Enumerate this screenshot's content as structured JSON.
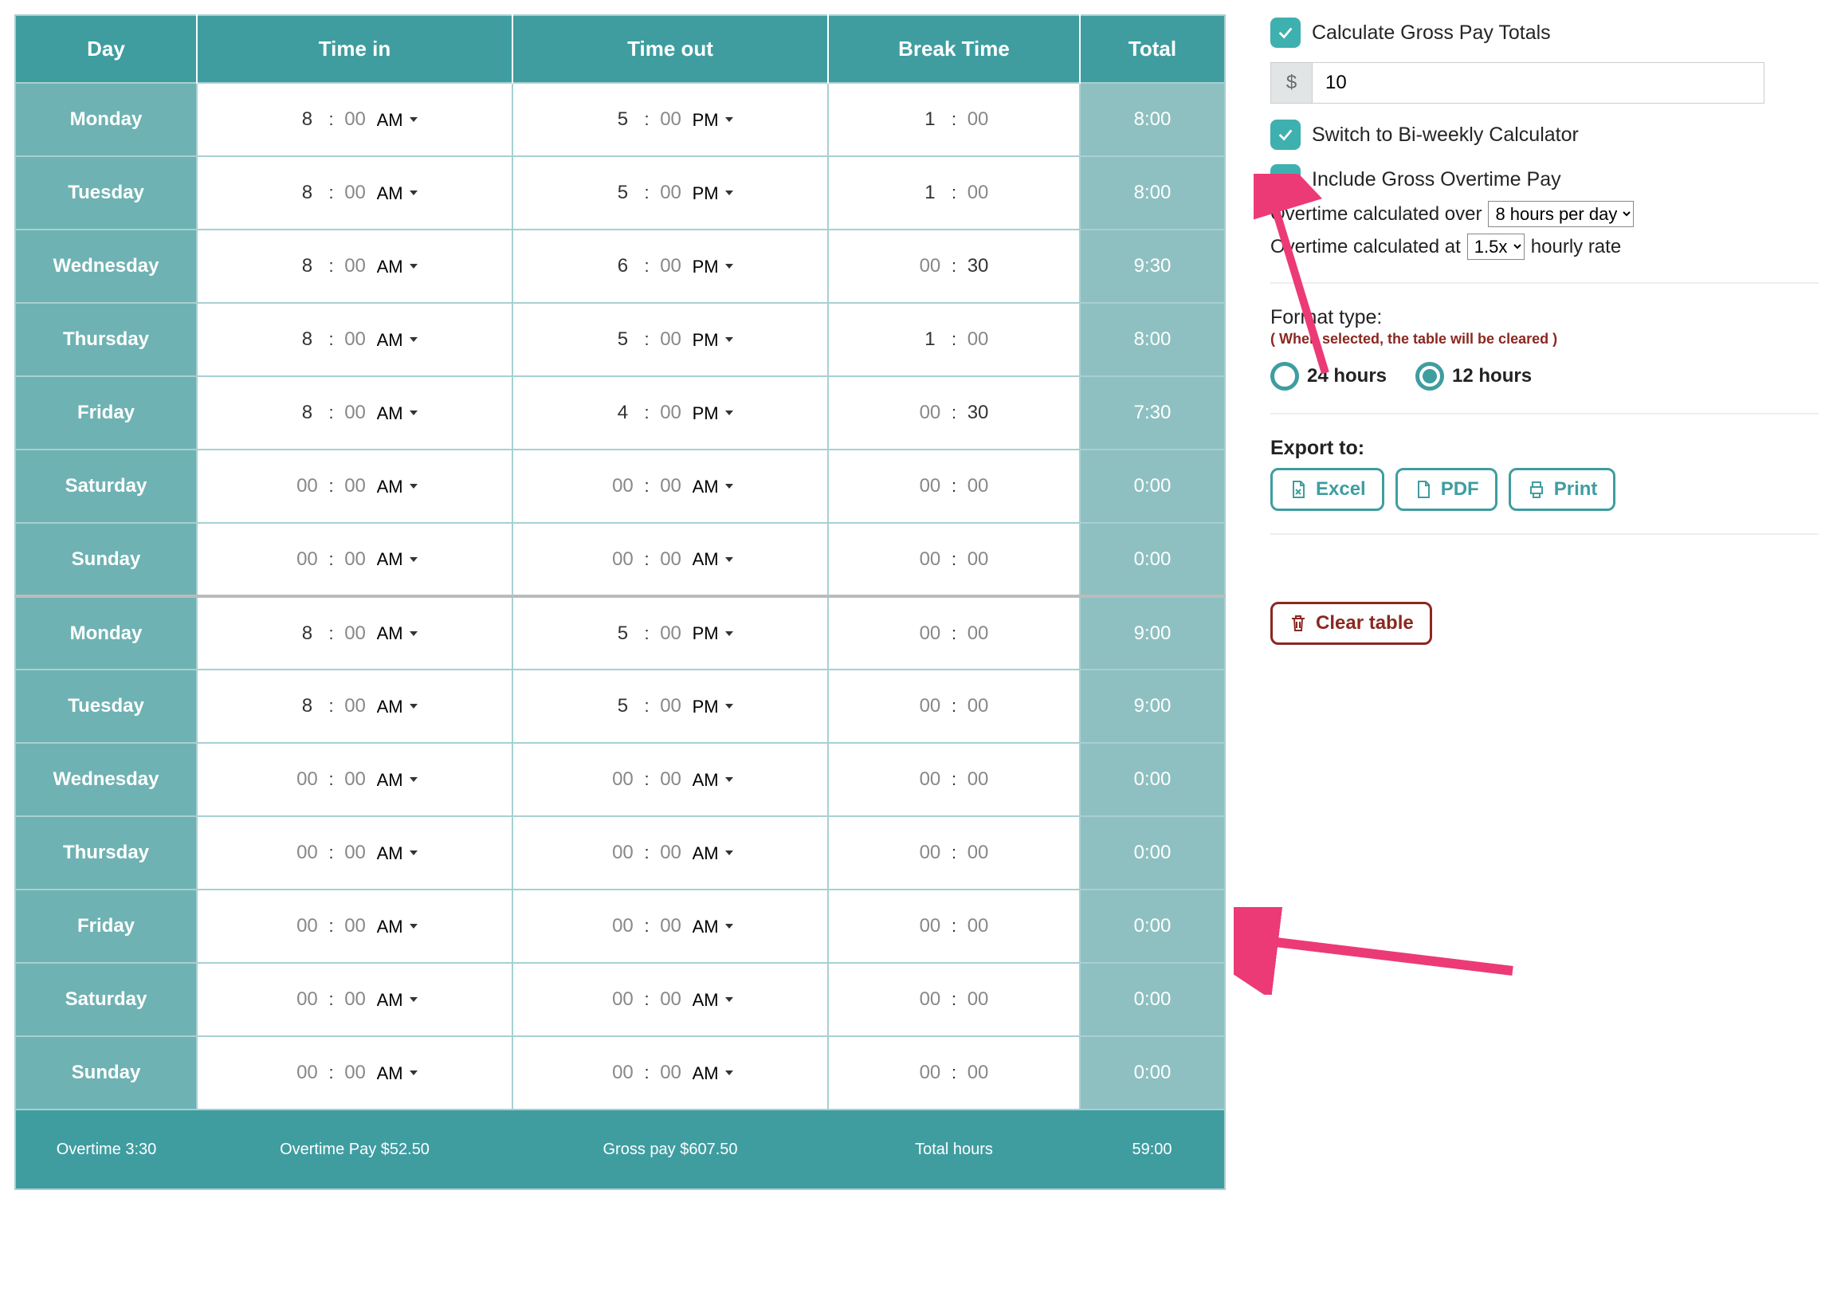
{
  "table": {
    "headers": {
      "day": "Day",
      "in": "Time in",
      "out": "Time out",
      "brk": "Break Time",
      "total": "Total"
    },
    "rows": [
      {
        "day": "Monday",
        "in_h": "8",
        "in_m": "00",
        "in_ap": "AM",
        "out_h": "5",
        "out_m": "00",
        "out_ap": "PM",
        "br_h": "1",
        "br_m": "00",
        "total": "8:00"
      },
      {
        "day": "Tuesday",
        "in_h": "8",
        "in_m": "00",
        "in_ap": "AM",
        "out_h": "5",
        "out_m": "00",
        "out_ap": "PM",
        "br_h": "1",
        "br_m": "00",
        "total": "8:00"
      },
      {
        "day": "Wednesday",
        "in_h": "8",
        "in_m": "00",
        "in_ap": "AM",
        "out_h": "6",
        "out_m": "00",
        "out_ap": "PM",
        "br_h": "00",
        "br_m": "30",
        "total": "9:30"
      },
      {
        "day": "Thursday",
        "in_h": "8",
        "in_m": "00",
        "in_ap": "AM",
        "out_h": "5",
        "out_m": "00",
        "out_ap": "PM",
        "br_h": "1",
        "br_m": "00",
        "total": "8:00"
      },
      {
        "day": "Friday",
        "in_h": "8",
        "in_m": "00",
        "in_ap": "AM",
        "out_h": "4",
        "out_m": "00",
        "out_ap": "PM",
        "br_h": "00",
        "br_m": "30",
        "total": "7:30"
      },
      {
        "day": "Saturday",
        "in_h": "00",
        "in_m": "00",
        "in_ap": "AM",
        "out_h": "00",
        "out_m": "00",
        "out_ap": "AM",
        "br_h": "00",
        "br_m": "00",
        "total": "0:00"
      },
      {
        "day": "Sunday",
        "in_h": "00",
        "in_m": "00",
        "in_ap": "AM",
        "out_h": "00",
        "out_m": "00",
        "out_ap": "AM",
        "br_h": "00",
        "br_m": "00",
        "total": "0:00"
      },
      {
        "day": "Monday",
        "in_h": "8",
        "in_m": "00",
        "in_ap": "AM",
        "out_h": "5",
        "out_m": "00",
        "out_ap": "PM",
        "br_h": "00",
        "br_m": "00",
        "total": "9:00"
      },
      {
        "day": "Tuesday",
        "in_h": "8",
        "in_m": "00",
        "in_ap": "AM",
        "out_h": "5",
        "out_m": "00",
        "out_ap": "PM",
        "br_h": "00",
        "br_m": "00",
        "total": "9:00"
      },
      {
        "day": "Wednesday",
        "in_h": "00",
        "in_m": "00",
        "in_ap": "AM",
        "out_h": "00",
        "out_m": "00",
        "out_ap": "AM",
        "br_h": "00",
        "br_m": "00",
        "total": "0:00"
      },
      {
        "day": "Thursday",
        "in_h": "00",
        "in_m": "00",
        "in_ap": "AM",
        "out_h": "00",
        "out_m": "00",
        "out_ap": "AM",
        "br_h": "00",
        "br_m": "00",
        "total": "0:00"
      },
      {
        "day": "Friday",
        "in_h": "00",
        "in_m": "00",
        "in_ap": "AM",
        "out_h": "00",
        "out_m": "00",
        "out_ap": "AM",
        "br_h": "00",
        "br_m": "00",
        "total": "0:00"
      },
      {
        "day": "Saturday",
        "in_h": "00",
        "in_m": "00",
        "in_ap": "AM",
        "out_h": "00",
        "out_m": "00",
        "out_ap": "AM",
        "br_h": "00",
        "br_m": "00",
        "total": "0:00"
      },
      {
        "day": "Sunday",
        "in_h": "00",
        "in_m": "00",
        "in_ap": "AM",
        "out_h": "00",
        "out_m": "00",
        "out_ap": "AM",
        "br_h": "00",
        "br_m": "00",
        "total": "0:00"
      }
    ],
    "footer": {
      "overtime": "Overtime 3:30",
      "overtime_pay": "Overtime Pay $52.50",
      "gross_pay": "Gross pay $607.50",
      "total_hours_lbl": "Total hours",
      "total_hours_val": "59:00"
    }
  },
  "sidebar": {
    "gross_label": "Calculate Gross Pay Totals",
    "rate_symbol": "$",
    "rate_value": "10",
    "biweekly_label": "Switch to Bi-weekly Calculator",
    "overtime_include_label": "Include Gross Overtime Pay",
    "overtime_over_text": "Overtime calculated over",
    "overtime_over_value": "8 hours per day",
    "overtime_at_pre": "Overtime calculated at",
    "overtime_at_value": "1.5x",
    "overtime_at_post": "hourly rate",
    "format_label": "Format type:",
    "format_warn": "( When selected, the table will be cleared )",
    "radio_24": "24 hours",
    "radio_12": "12 hours",
    "export_label": "Export to:",
    "btn_excel": "Excel",
    "btn_pdf": "PDF",
    "btn_print": "Print",
    "btn_clear": "Clear table"
  }
}
